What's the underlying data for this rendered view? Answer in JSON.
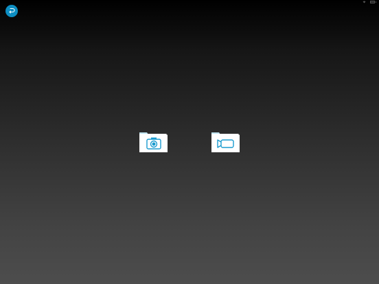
{
  "status_bar": {
    "left_text": "",
    "battery_text": ""
  },
  "toolbar": {
    "back_icon": "back-arrow-icon",
    "accent_color": "#0d8ec2"
  },
  "folders": [
    {
      "name": "photos-folder",
      "icon": "camera-icon"
    },
    {
      "name": "videos-folder",
      "icon": "video-camera-icon"
    }
  ],
  "colors": {
    "folder_fill": "#ffffff",
    "folder_tab": "#bfe3f0",
    "folder_icon": "#1a9bcf"
  }
}
